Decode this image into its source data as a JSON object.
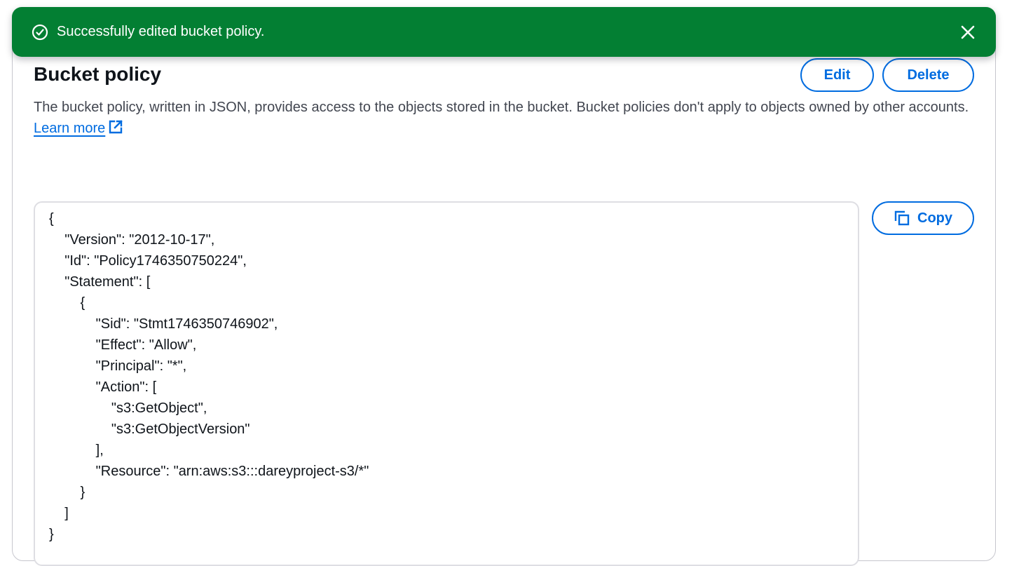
{
  "flash": {
    "message": "Successfully edited bucket policy.",
    "background": "#037f33",
    "success_icon": "check-circle-icon",
    "close_icon": "close-icon"
  },
  "section": {
    "title": "Bucket policy",
    "edit_label": "Edit",
    "delete_label": "Delete",
    "description": "The bucket policy, written in JSON, provides access to the objects stored in the bucket. Bucket policies don't apply to objects owned by other accounts.",
    "learn_more": "Learn more",
    "external_icon": "external-link-icon",
    "accent": "#006ce0"
  },
  "policy": {
    "copy_label": "Copy",
    "copy_icon": "copy-icon",
    "lines": [
      "{",
      "    \"Version\": \"2012-10-17\",",
      "    \"Id\": \"Policy1746350750224\",",
      "    \"Statement\": [",
      "        {",
      "            \"Sid\": \"Stmt1746350746902\",",
      "            \"Effect\": \"Allow\",",
      "            \"Principal\": \"*\",",
      "            \"Action\": [",
      "                \"s3:GetObject\",",
      "                \"s3:GetObjectVersion\"",
      "            ],",
      "            \"Resource\": \"arn:aws:s3:::dareyproject-s3/*\"",
      "        }",
      "    ]",
      "}"
    ]
  }
}
